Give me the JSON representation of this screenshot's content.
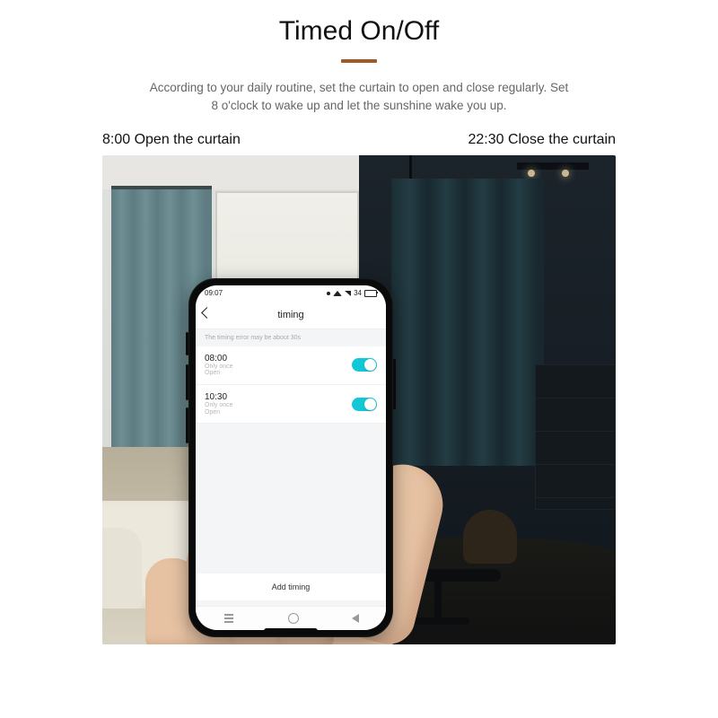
{
  "header": {
    "title": "Timed On/Off",
    "description": "According to your daily routine, set the curtain to open and close regularly. Set 8 o'clock to wake up and let the sunshine wake you up."
  },
  "scene": {
    "left_label": "8:00 Open the curtain",
    "right_label": "22:30 Close the curtain"
  },
  "phone": {
    "status_time": "09:07",
    "status_battery": "34",
    "appbar_title": "timing",
    "notice": "The timing error may be about 30s",
    "timers": [
      {
        "time": "08:00",
        "repeat": "Only once",
        "action": "Open",
        "on": true
      },
      {
        "time": "10:30",
        "repeat": "Only once",
        "action": "Open",
        "on": true
      }
    ],
    "add_button": "Add timing"
  },
  "colors": {
    "accent": "#12c8d6",
    "rule": "#9c5b2b"
  }
}
